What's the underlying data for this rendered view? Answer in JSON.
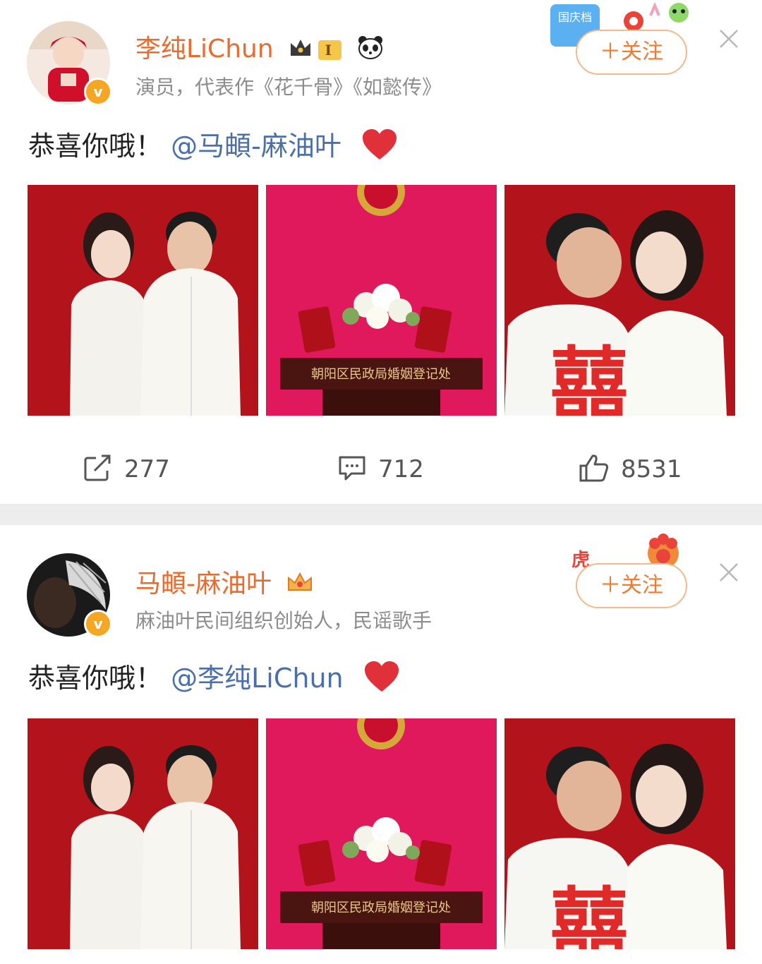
{
  "posts": [
    {
      "username": "李纯LiChun",
      "bio": "演员，代表作《花千骨》《如懿传》",
      "level": "I",
      "follow_label": "＋关注",
      "text_prefix": "恭喜你哦！",
      "mention": "@马頔-麻油叶",
      "photos": [
        {
          "caption": ""
        },
        {
          "caption": "朝阳区民政局婚姻登记处"
        },
        {
          "caption": "囍"
        }
      ],
      "stats": {
        "reposts": "277",
        "comments": "712",
        "likes": "8531"
      }
    },
    {
      "username": "马頔-麻油叶",
      "bio": "麻油叶民间组织创始人，民谣歌手",
      "follow_label": "＋关注",
      "text_prefix": "恭喜你哦！",
      "mention": "@李纯LiChun",
      "photos": [
        {
          "caption": ""
        },
        {
          "caption": "朝阳区民政局婚姻登记处"
        },
        {
          "caption": "囍"
        }
      ]
    }
  ],
  "badges": {
    "verified": "v",
    "deco1": "国庆档",
    "deco2": "虎"
  },
  "colors": {
    "accent": "#e86b2f",
    "link": "#4b6fa8",
    "heart": "#e0303a",
    "photo_red": "#b3141b",
    "photo_pink": "#e0185c"
  }
}
